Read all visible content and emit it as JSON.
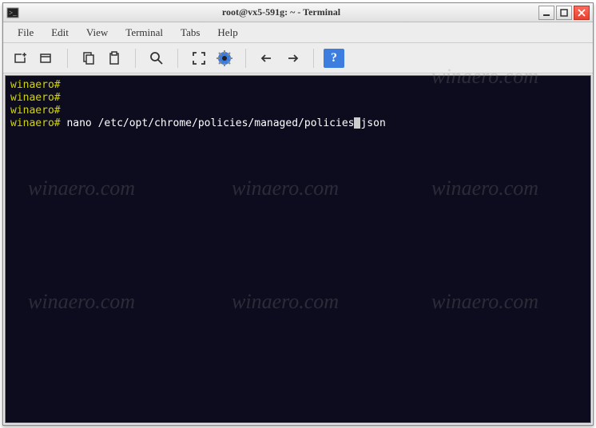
{
  "window": {
    "title": "root@vx5-591g: ~ - Terminal"
  },
  "menubar": {
    "file": "File",
    "edit": "Edit",
    "view": "View",
    "terminal": "Terminal",
    "tabs": "Tabs",
    "help": "Help"
  },
  "toolbar": {
    "help_label": "?"
  },
  "terminal": {
    "prompt": "winaero#",
    "command": "nano /etc/opt/chrome/policies/managed/policies",
    "command_tail": "json"
  },
  "watermark": "winaero.com"
}
